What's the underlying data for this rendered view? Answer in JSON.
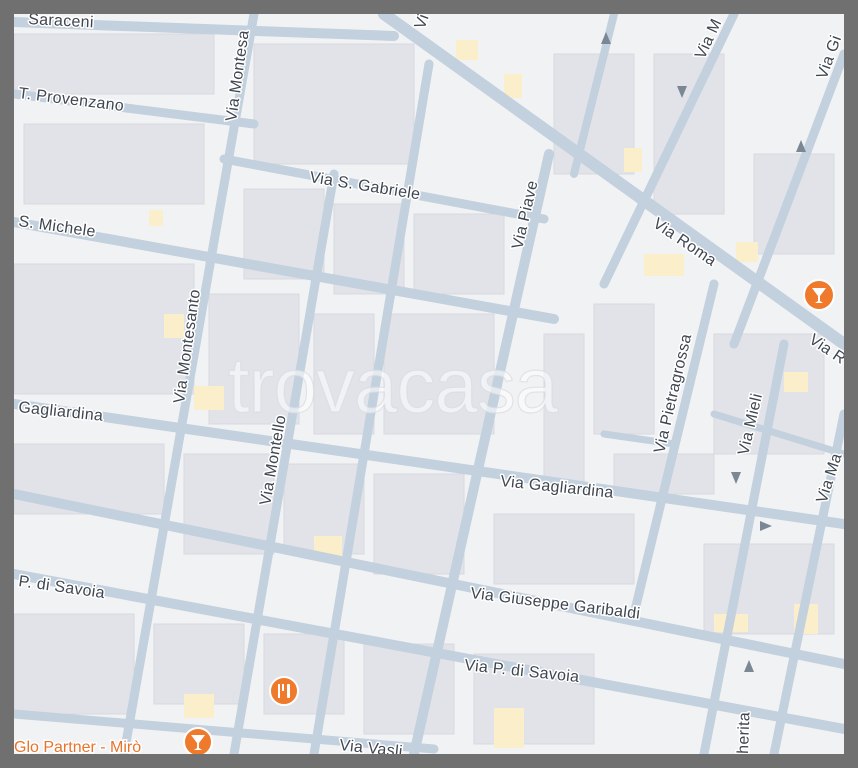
{
  "map": {
    "watermark": "trovacasa",
    "streets": {
      "top_cut": "Saraceni",
      "provenzano": "T. Provenzano",
      "gabriele": "Via S. Gabriele",
      "michele": "S. Michele",
      "montesanto_top": "Via Montesa",
      "montesanto": "Via Montesanto",
      "montello": "Via Montello",
      "piave": "Via Piave",
      "roma": "Via Roma",
      "roma_right": "Via R",
      "pietragrossa": "Via Pietragrossa",
      "mieli": "Via Mieli",
      "gagliardina_left": "Gagliardina",
      "gagliardina": "Via Gagliardina",
      "savoia_left": "P. di Savoia",
      "garibaldi": "Via Giuseppe Garibaldi",
      "savoia": "Via P. di Savoia",
      "vasto": "Via Vasli",
      "top_via_m": "Via M",
      "top_via_gi": "Via Gi",
      "top_vi": "Vi",
      "via_ma": "Via Ma",
      "herita": "herita"
    },
    "pois": {
      "bar_label": "Glo Partner - Mirò",
      "bar_icon": "cocktail-icon",
      "restaurant_icon": "restaurant-icon",
      "bar2_icon": "cocktail-icon"
    },
    "colors": {
      "road": "#c3d0dd",
      "block": "#e1e3e8",
      "background": "#f1f2f4",
      "poi": "#ef7a2c",
      "label": "#3f4650"
    }
  }
}
